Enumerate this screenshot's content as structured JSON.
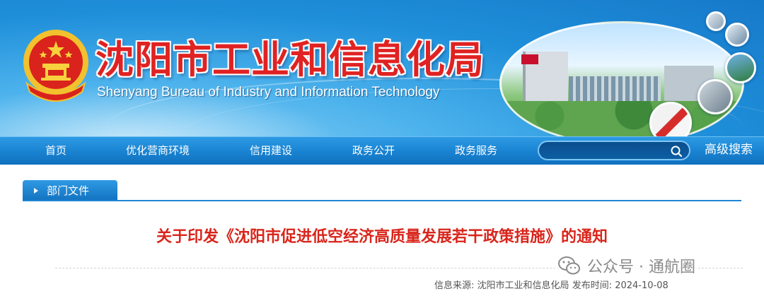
{
  "banner": {
    "title_cn": "沈阳市工业和信息化局",
    "title_en": "Shenyang Bureau of Industry and Information Technology",
    "emblem_icon": "national-emblem-icon",
    "photo_sign": "RSP"
  },
  "nav": {
    "items": [
      {
        "label": "首页"
      },
      {
        "label": "优化营商环境"
      },
      {
        "label": "信用建设"
      },
      {
        "label": "政务公开"
      },
      {
        "label": "政务服务"
      }
    ],
    "search": {
      "placeholder": "",
      "value": "",
      "icon": "search-icon"
    },
    "advanced_search_label": "高级搜索"
  },
  "section": {
    "tab_label": "部门文件"
  },
  "article": {
    "title": "关于印发《沈阳市促进低空经济高质量发展若干政策措施》的通知",
    "source_label": "信息来源:",
    "source_value": "沈阳市工业和信息化局",
    "published_label": "发布时间:",
    "published_value": "2024-10-08"
  },
  "watermark": {
    "text": "公众号 · 通航圈",
    "icon": "wechat-icon"
  },
  "colors": {
    "banner_blue": "#1f8fda",
    "nav_blue": "#1a84d2",
    "title_red": "#e02222",
    "article_title_red": "#d9251b"
  }
}
